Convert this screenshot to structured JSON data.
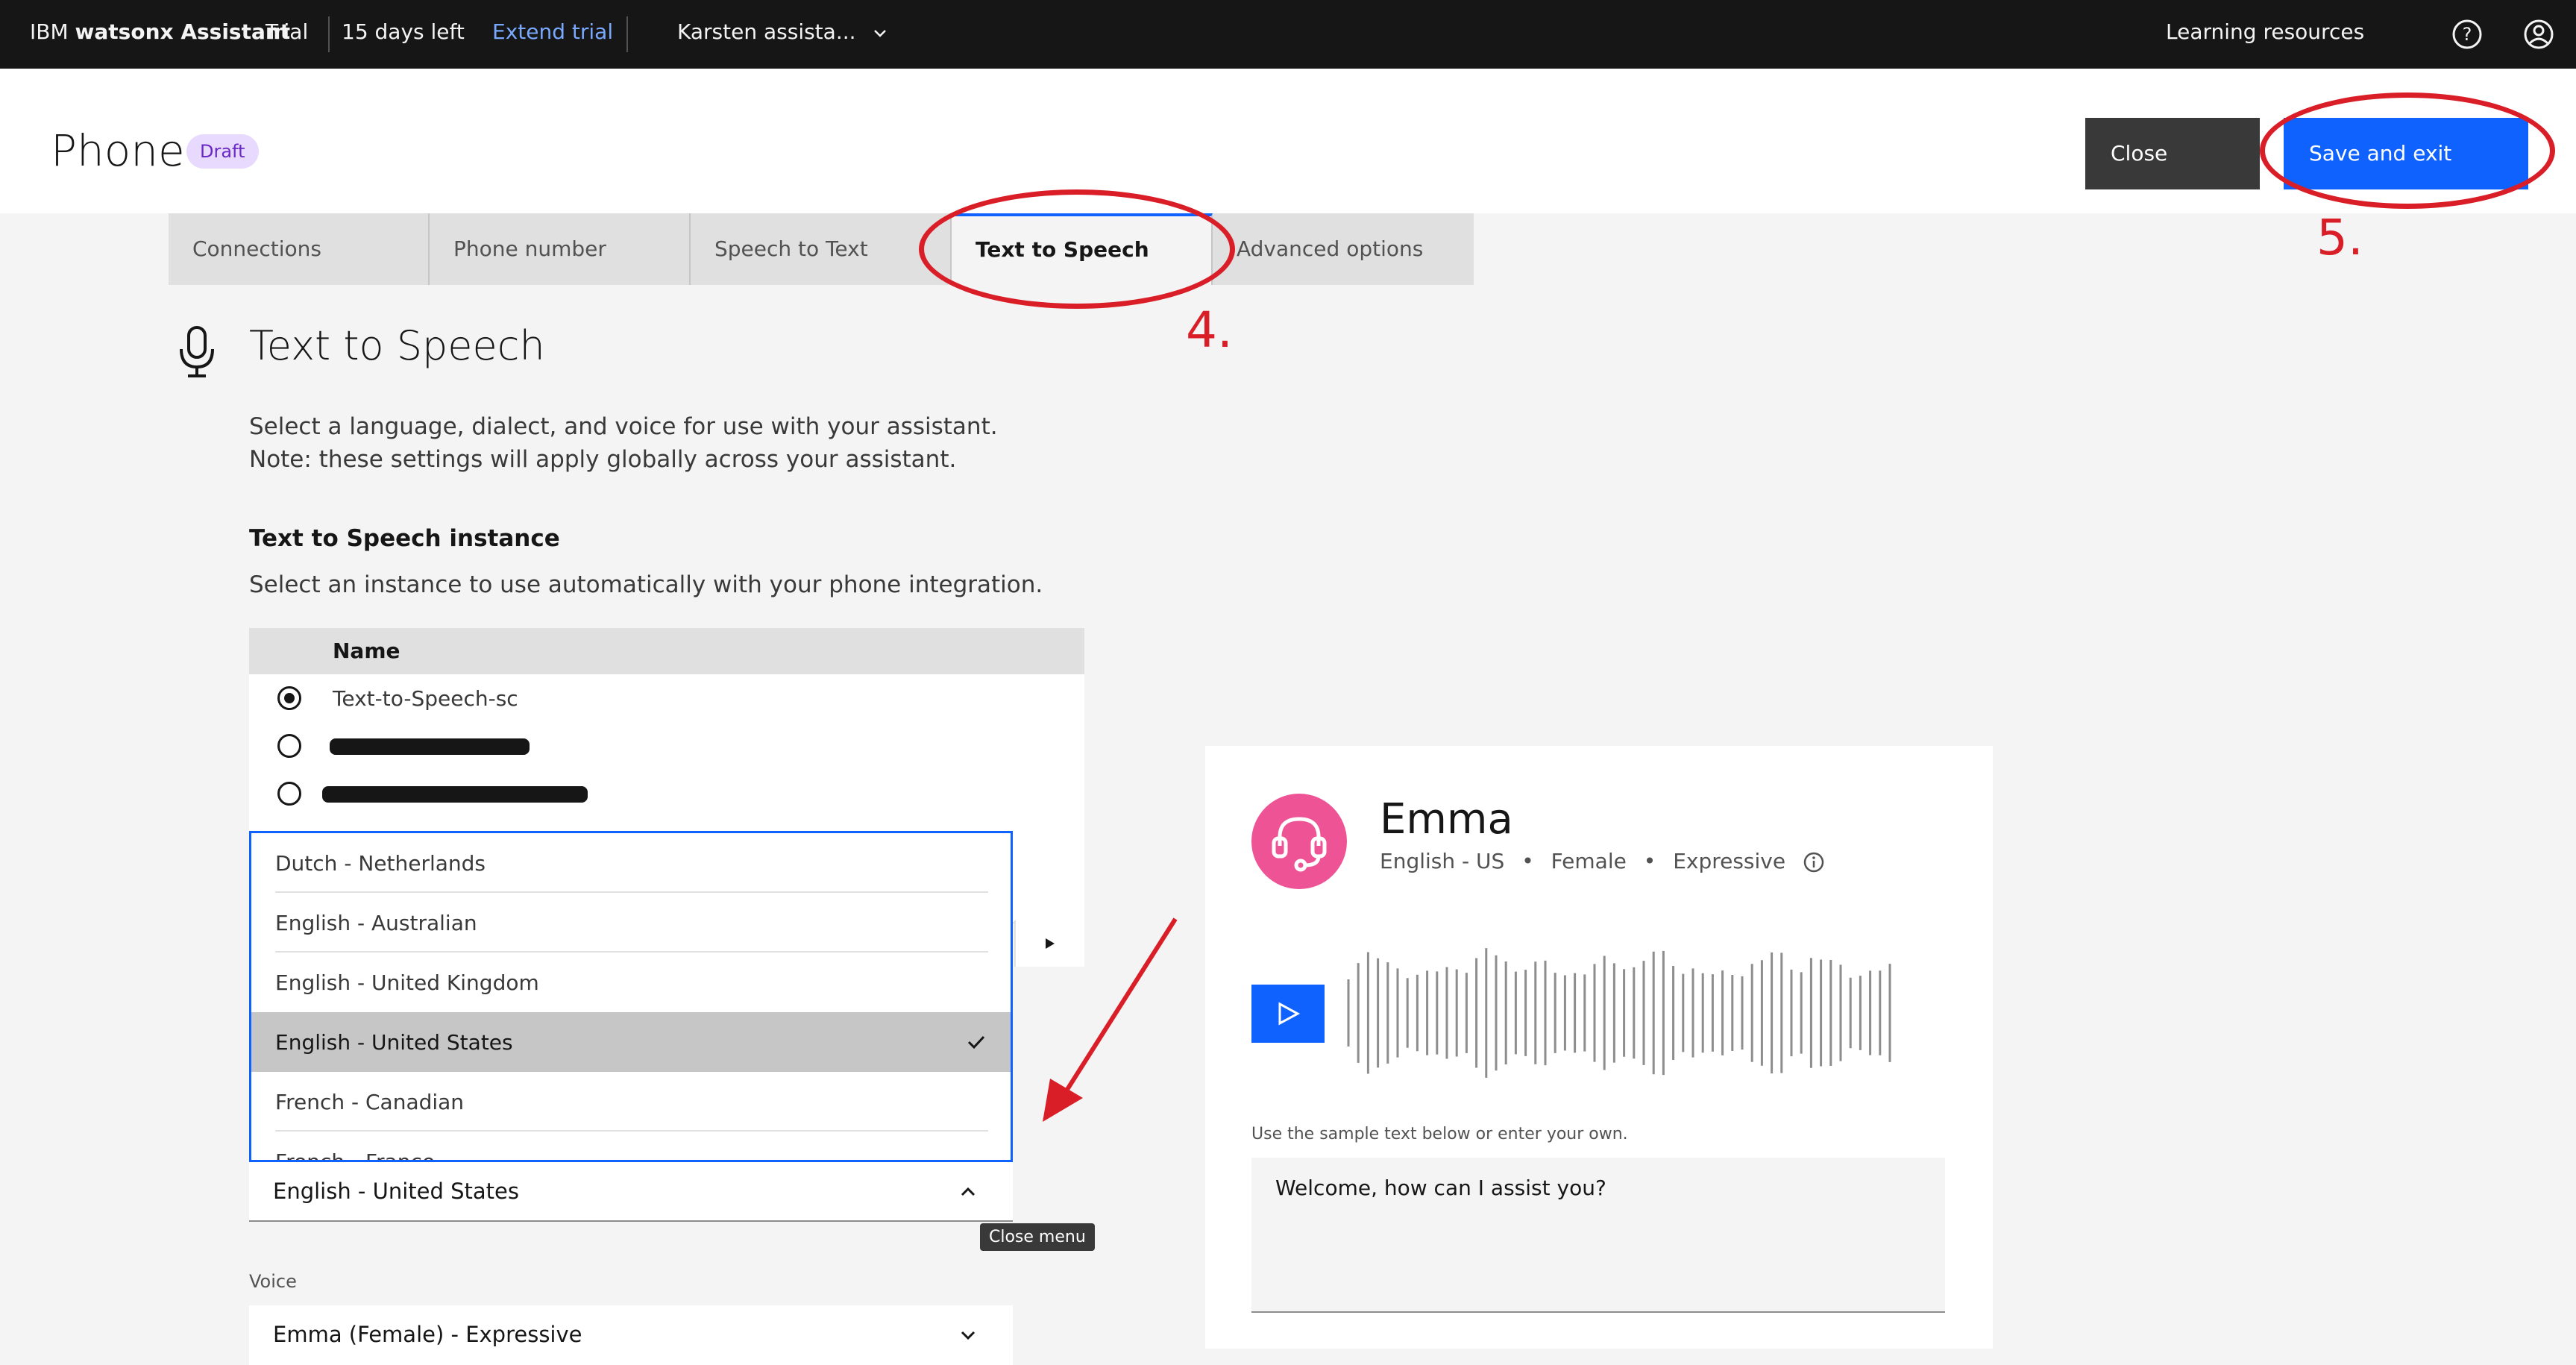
{
  "topbar": {
    "brand_prefix": "IBM ",
    "brand_bold": "watsonx Assistant",
    "plan": "Trial",
    "days_left": "15 days left",
    "extend_trial": "Extend trial",
    "assistant_switcher": "Karsten assista...",
    "learning_resources": "Learning resources"
  },
  "header": {
    "title": "Phone",
    "badge": "Draft",
    "close_label": "Close",
    "save_label": "Save and exit"
  },
  "tabs": [
    {
      "label": "Connections"
    },
    {
      "label": "Phone number"
    },
    {
      "label": "Speech to Text"
    },
    {
      "label": "Text to Speech"
    },
    {
      "label": "Advanced options"
    }
  ],
  "annotations": {
    "step4": "4.",
    "step5": "5."
  },
  "section": {
    "title": "Text to Speech",
    "desc_line1": "Select a language, dialect, and voice for use with your assistant.",
    "desc_line2": "Note: these settings will apply globally across your assistant.",
    "instance_heading": "Text to Speech instance",
    "instance_desc": "Select an instance to use automatically with your phone integration."
  },
  "instance_table": {
    "header": "Name",
    "rows": [
      {
        "name": "Text-to-Speech-sc",
        "selected": true
      },
      {
        "name": "",
        "selected": false
      },
      {
        "name": "",
        "selected": false
      }
    ]
  },
  "language_menu": {
    "options": [
      "Dutch - Netherlands",
      "English - Australian",
      "English - United Kingdom",
      "English - United States",
      "French - Canadian",
      "French - France"
    ],
    "selected": "English - United States",
    "current_value": "English - United States",
    "tooltip": "Close menu"
  },
  "voice": {
    "label": "Voice",
    "value": "Emma (Female) - Expressive"
  },
  "preview": {
    "name": "Emma",
    "language": "English - US",
    "gender": "Female",
    "style": "Expressive",
    "sample_label": "Use the sample text below or enter your own.",
    "sample_text": "Welcome, how can I assist you?"
  },
  "colors": {
    "accent": "#0f62fe",
    "annotation": "#da1e28",
    "avatar": "#ee5396"
  }
}
